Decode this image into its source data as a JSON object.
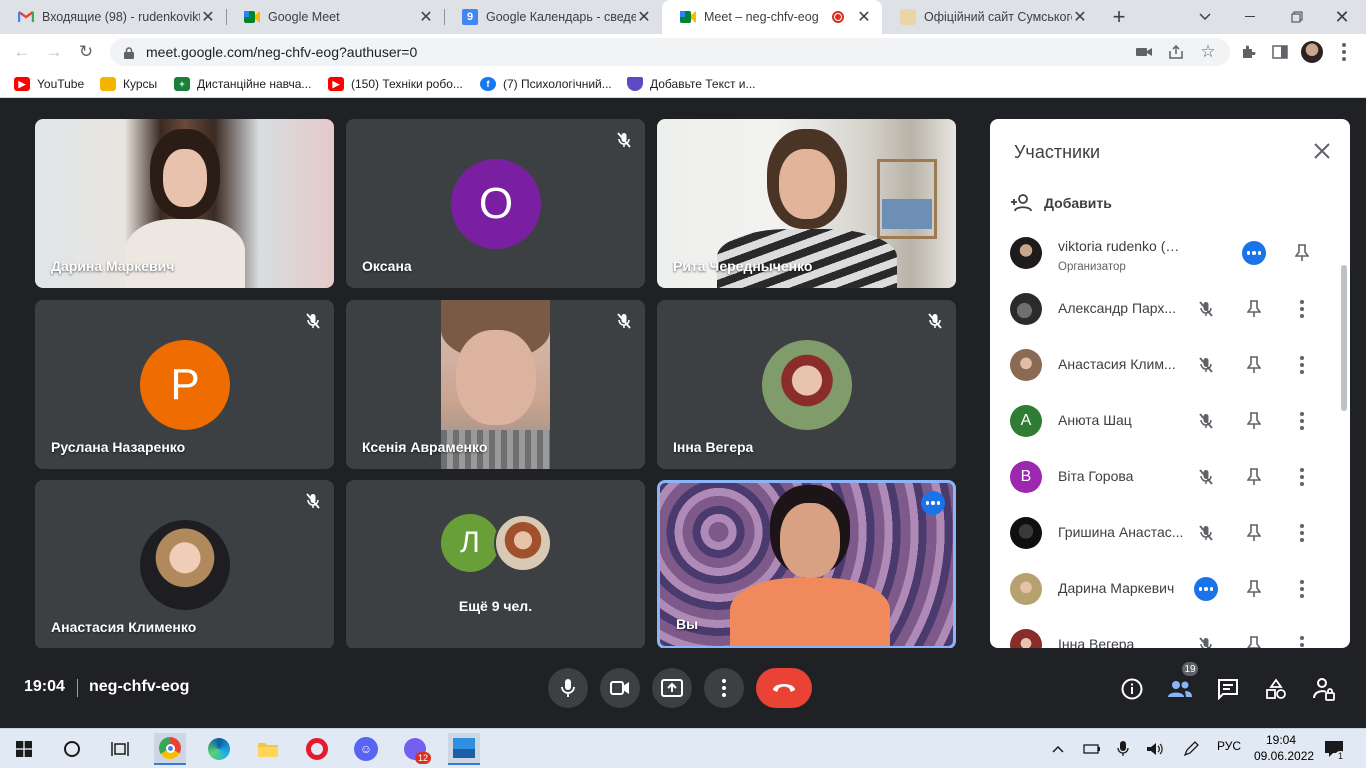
{
  "browser": {
    "tabs": [
      {
        "title": "Входящие (98) - rudenkovikt",
        "icon": "gmail-icon"
      },
      {
        "title": "Google Meet",
        "icon": "meet-icon"
      },
      {
        "title": "Google Календарь - сведен",
        "icon": "calendar-icon",
        "icon_text": "9"
      },
      {
        "title": "Meet – neg-chfv-eog",
        "icon": "meet-icon",
        "active": true,
        "recording": true
      },
      {
        "title": "Офіційний сайт Сумського /",
        "icon": "site-icon"
      }
    ],
    "new_tab": "+",
    "url": "meet.google.com/neg-chfv-eog?authuser=0",
    "bookmarks": [
      {
        "label": "YouTube",
        "icon": "youtube-icon"
      },
      {
        "label": "Курсы",
        "icon": "classroom-icon"
      },
      {
        "label": "Дистанційне навча...",
        "icon": "green-icon"
      },
      {
        "label": "(150) Техніки робо...",
        "icon": "youtube-icon"
      },
      {
        "label": "(7) Психологічний...",
        "icon": "facebook-icon"
      },
      {
        "label": "Добавьте Текст и...",
        "icon": "shield-icon"
      }
    ]
  },
  "meeting": {
    "tiles": [
      {
        "name": "Дарина Маркевич",
        "kind": "video",
        "muted": false
      },
      {
        "name": "Оксана",
        "kind": "avatar",
        "letter": "О",
        "color": "#7b1fa2",
        "muted": true
      },
      {
        "name": "Рита Чередныченко",
        "kind": "video",
        "muted": false
      },
      {
        "name": "Руслана Назаренко",
        "kind": "avatar",
        "letter": "P",
        "color": "#ef6c00",
        "muted": true
      },
      {
        "name": "Ксенія Авраменко",
        "kind": "video",
        "muted": true
      },
      {
        "name": "Інна Вегера",
        "kind": "photo",
        "muted": true
      },
      {
        "name": "Анастасия Клименко",
        "kind": "photo",
        "muted": true
      },
      {
        "name": "Ещё 9 чел.",
        "kind": "more",
        "letter": "Л",
        "color": "#689f38",
        "muted": false
      },
      {
        "name": "Вы",
        "kind": "self",
        "muted": false
      }
    ],
    "time": "19:04",
    "code": "neg-chfv-eog",
    "participants_count": "19"
  },
  "panel": {
    "title": "Участники",
    "add_label": "Добавить",
    "people": [
      {
        "name": "viktoria rudenko (вы)",
        "sub": "Организатор",
        "avatar": "photo",
        "action": "more-blue",
        "mic": false
      },
      {
        "name": "Александр Парх...",
        "avatar": "photo",
        "action": "more",
        "mic": true
      },
      {
        "name": "Анастасия Клим...",
        "avatar": "photo",
        "action": "more",
        "mic": true
      },
      {
        "name": "Анюта Шац",
        "avatar": "letter",
        "letter": "А",
        "color": "#2e7d32",
        "action": "more",
        "mic": true
      },
      {
        "name": "Віта Горова",
        "avatar": "letter",
        "letter": "В",
        "color": "#9c27b0",
        "action": "more",
        "mic": true
      },
      {
        "name": "Гришина Анастас...",
        "avatar": "photo",
        "action": "more",
        "mic": true
      },
      {
        "name": "Дарина Маркевич",
        "avatar": "photo",
        "action": "more",
        "mic": false,
        "speaking": true
      },
      {
        "name": "Інна Вегера",
        "avatar": "photo",
        "action": "more",
        "mic": true
      }
    ]
  },
  "taskbar": {
    "lang": "РУС",
    "time": "19:04",
    "date": "09.06.2022",
    "viber_badge": "12",
    "notif_count": "1"
  }
}
